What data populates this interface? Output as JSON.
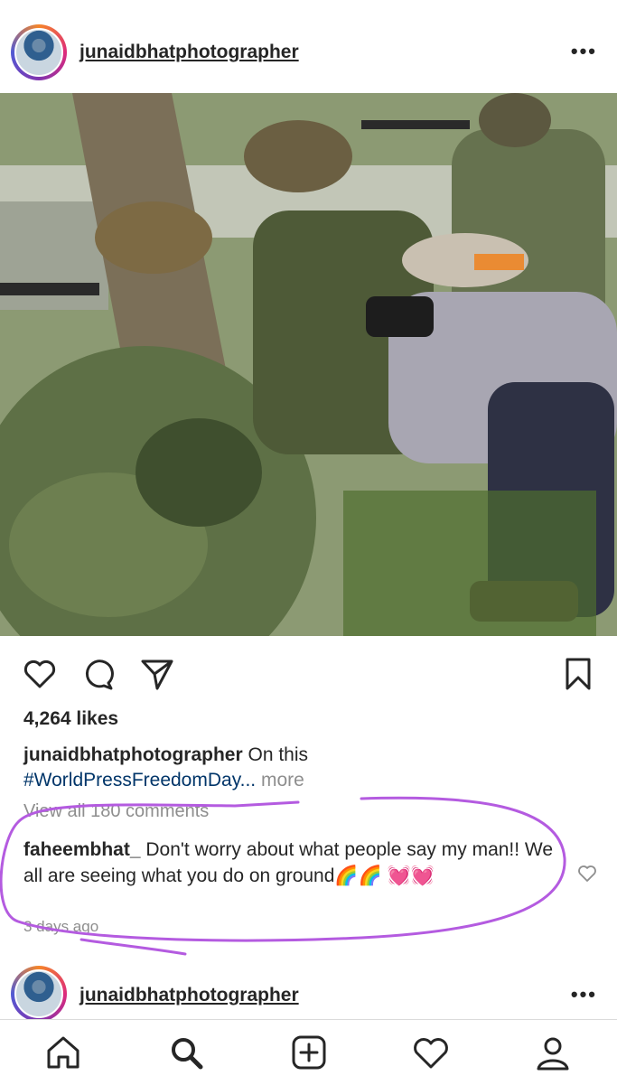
{
  "post": {
    "username": "junaidbhatphotographer",
    "more_label": "•••",
    "likes": "4,264 likes",
    "caption_user": "junaidbhatphotographer",
    "caption_text": "On this",
    "caption_hashtag": "#WorldPressFreedomDay...",
    "caption_more": "more",
    "view_all": "View all 180 comments",
    "comment_user": "faheembhat_",
    "comment_text": "Don't worry about what people say my man!! We all are seeing what you do on ground🌈🌈 💓💓",
    "timestamp": "3 days ago"
  },
  "next_post": {
    "username": "junaidbhatphotographer",
    "more_label": "•••"
  },
  "icons": {
    "like": "heart-icon",
    "comment": "comment-icon",
    "share": "send-icon",
    "save": "bookmark-icon",
    "home": "home-icon",
    "search": "search-icon",
    "add": "add-post-icon",
    "activity": "heart-icon",
    "profile": "profile-icon"
  },
  "colors": {
    "annotation": "#b45be0",
    "hashtag": "#003569",
    "muted": "#8e8e8e"
  }
}
